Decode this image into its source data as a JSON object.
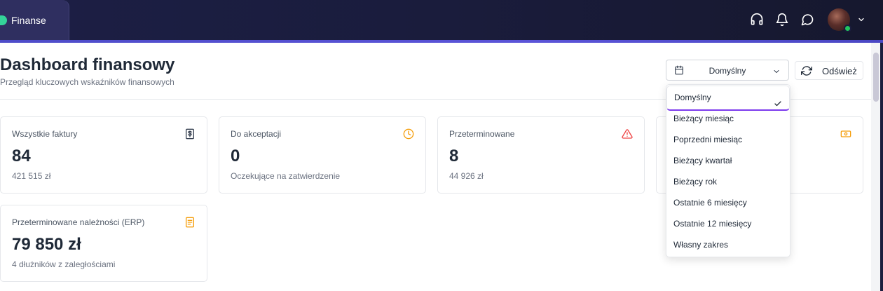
{
  "app": {
    "name": "Finanse"
  },
  "header": {
    "title": "Dashboard finansowy",
    "subtitle": "Przegląd kluczowych wskaźników finansowych"
  },
  "topbar_icons": [
    "headset-icon",
    "bell-icon",
    "chat-icon",
    "avatar",
    "chevron-down-icon"
  ],
  "period_select": {
    "value": "Domyślny",
    "options": [
      "Domyślny",
      "Bieżący miesiąc",
      "Poprzedni miesiąc",
      "Bieżący kwartał",
      "Bieżący rok",
      "Ostatnie 6 miesięcy",
      "Ostatnie 12 miesięcy",
      "Własny zakres"
    ]
  },
  "refresh": {
    "label": "Odśwież"
  },
  "cards": [
    {
      "title": "Wszystkie faktury",
      "value": "84",
      "sub": "421 515 zł",
      "icon": "dollar-document-icon"
    },
    {
      "title": "Do akceptacji",
      "value": "0",
      "sub": "Oczekujące na zatwierdzenie",
      "icon": "clock-icon"
    },
    {
      "title": "Przeterminowane",
      "value": "8",
      "sub": "44 926 zł",
      "icon": "warning-icon"
    },
    {
      "title": "",
      "value": "",
      "sub": "",
      "icon": "banknote-icon"
    },
    {
      "title": "Przeterminowane należności (ERP)",
      "value": "79 850 zł",
      "sub": "4 dłużników z zaległościami",
      "icon": "document-icon"
    }
  ],
  "colors": {
    "accent": "#7c3aed",
    "clock": "#f59e0b",
    "warning": "#ef4444",
    "doc": "#f59e0b",
    "status_online": "#22c55e"
  }
}
